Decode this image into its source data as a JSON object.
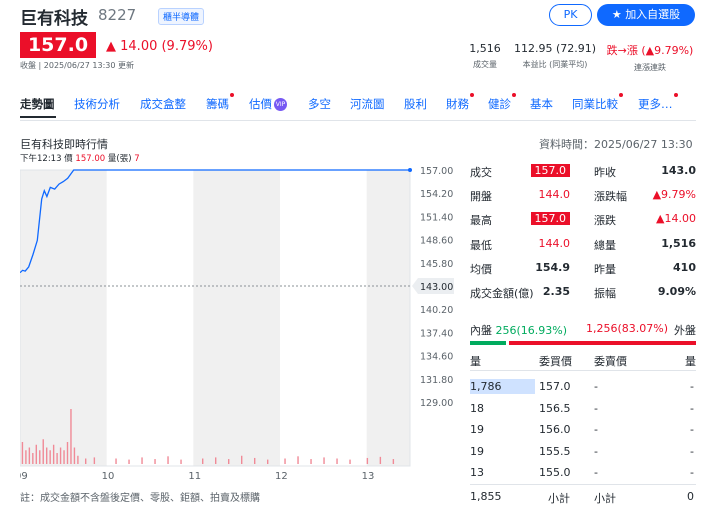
{
  "header": {
    "name": "巨有科技",
    "code": "8227",
    "badge": "櫃半導體",
    "pk": "PK",
    "watch": "加入自選股",
    "price": "157.0",
    "change": "14.00 (9.79%)",
    "close_time": "收盤 | 2025/06/27 13:30 更新"
  },
  "stats": [
    {
      "value": "1,516",
      "label": "成交量"
    },
    {
      "value": "112.95 (72.91)",
      "label": "本益比 (同業平均)"
    },
    {
      "value": "跌→漲 (▲9.79%)",
      "label": "連漲連跌"
    }
  ],
  "tabs": [
    "走勢圖",
    "技術分析",
    "成交盒整",
    "籌碼",
    "估價",
    "多空",
    "河流圖",
    "股利",
    "財務",
    "健診",
    "基本",
    "同業比較",
    "更多…"
  ],
  "tab_vip": "VIP",
  "chart": {
    "title": "巨有科技即時行情",
    "data_time": "資料時間：2025/06/27 13:30",
    "info_time": "下午12:13",
    "info_price_label": "價",
    "info_price": "157.00",
    "info_vol_label": "量(張)",
    "info_vol": "7",
    "ref_price": "143.00",
    "note": "註：成交金額不含盤後定價、零股、鉅額、拍賣及標購"
  },
  "chart_data": {
    "type": "line",
    "x_ticks": [
      "09",
      "10",
      "11",
      "12",
      "13"
    ],
    "y_ticks": [
      "157.00",
      "154.20",
      "151.40",
      "148.60",
      "145.80",
      "143.00",
      "140.20",
      "137.40",
      "134.60",
      "131.80",
      "129.00"
    ],
    "ylim": [
      129,
      157
    ],
    "reference": 143.0,
    "price_series": [
      {
        "t": 9.0,
        "v": 144.6
      },
      {
        "t": 9.03,
        "v": 144.9
      },
      {
        "t": 9.06,
        "v": 144.8
      },
      {
        "t": 9.1,
        "v": 145.3
      },
      {
        "t": 9.15,
        "v": 146.8
      },
      {
        "t": 9.2,
        "v": 148.5
      },
      {
        "t": 9.25,
        "v": 153.5
      },
      {
        "t": 9.28,
        "v": 154.5
      },
      {
        "t": 9.31,
        "v": 153.8
      },
      {
        "t": 9.35,
        "v": 154.9
      },
      {
        "t": 9.4,
        "v": 154.7
      },
      {
        "t": 9.45,
        "v": 155.3
      },
      {
        "t": 9.5,
        "v": 155.6
      },
      {
        "t": 9.55,
        "v": 156.0
      },
      {
        "t": 9.62,
        "v": 157.0
      },
      {
        "t": 10.0,
        "v": 157.0
      },
      {
        "t": 11.0,
        "v": 157.0
      },
      {
        "t": 12.0,
        "v": 157.0
      },
      {
        "t": 13.0,
        "v": 157.0
      },
      {
        "t": 13.5,
        "v": 157.0
      }
    ],
    "volume_series": [
      {
        "t": 9.02,
        "v": 40
      },
      {
        "t": 9.06,
        "v": 25
      },
      {
        "t": 9.1,
        "v": 30
      },
      {
        "t": 9.14,
        "v": 20
      },
      {
        "t": 9.18,
        "v": 35
      },
      {
        "t": 9.22,
        "v": 25
      },
      {
        "t": 9.26,
        "v": 45
      },
      {
        "t": 9.3,
        "v": 30
      },
      {
        "t": 9.34,
        "v": 25
      },
      {
        "t": 9.38,
        "v": 35
      },
      {
        "t": 9.42,
        "v": 20
      },
      {
        "t": 9.46,
        "v": 30
      },
      {
        "t": 9.5,
        "v": 25
      },
      {
        "t": 9.54,
        "v": 40
      },
      {
        "t": 9.58,
        "v": 100
      },
      {
        "t": 9.62,
        "v": 30
      },
      {
        "t": 9.66,
        "v": 15
      },
      {
        "t": 9.75,
        "v": 10
      },
      {
        "t": 9.85,
        "v": 12
      },
      {
        "t": 10.1,
        "v": 10
      },
      {
        "t": 10.25,
        "v": 8
      },
      {
        "t": 10.4,
        "v": 12
      },
      {
        "t": 10.55,
        "v": 9
      },
      {
        "t": 10.7,
        "v": 14
      },
      {
        "t": 10.85,
        "v": 8
      },
      {
        "t": 11.1,
        "v": 10
      },
      {
        "t": 11.25,
        "v": 12
      },
      {
        "t": 11.4,
        "v": 9
      },
      {
        "t": 11.55,
        "v": 15
      },
      {
        "t": 11.7,
        "v": 11
      },
      {
        "t": 11.85,
        "v": 8
      },
      {
        "t": 12.05,
        "v": 10
      },
      {
        "t": 12.2,
        "v": 14
      },
      {
        "t": 12.35,
        "v": 9
      },
      {
        "t": 12.5,
        "v": 12
      },
      {
        "t": 12.65,
        "v": 10
      },
      {
        "t": 12.8,
        "v": 8
      },
      {
        "t": 13.0,
        "v": 11
      },
      {
        "t": 13.15,
        "v": 13
      },
      {
        "t": 13.3,
        "v": 9
      }
    ]
  },
  "quote": {
    "left": [
      {
        "label": "成交",
        "value": "157.0",
        "style": "hl"
      },
      {
        "label": "開盤",
        "value": "144.0",
        "style": "red"
      },
      {
        "label": "最高",
        "value": "157.0",
        "style": "hl"
      },
      {
        "label": "最低",
        "value": "144.0",
        "style": "red"
      },
      {
        "label": "均價",
        "value": "154.9",
        "style": ""
      },
      {
        "label": "成交金額(億)",
        "value": "2.35",
        "style": ""
      }
    ],
    "right": [
      {
        "label": "昨收",
        "value": "143.0",
        "style": ""
      },
      {
        "label": "漲跌幅",
        "value": "▲9.79%",
        "style": "red"
      },
      {
        "label": "漲跌",
        "value": "▲14.00",
        "style": "red"
      },
      {
        "label": "總量",
        "value": "1,516",
        "style": ""
      },
      {
        "label": "昨量",
        "value": "410",
        "style": ""
      },
      {
        "label": "振幅",
        "value": "9.09%",
        "style": ""
      }
    ]
  },
  "inout": {
    "in_label": "內盤",
    "in_value": "256(16.93%)",
    "out_value": "1,256(83.07%)",
    "out_label": "外盤"
  },
  "orderbook": {
    "headers": [
      "量",
      "委買價",
      "委賣價",
      "量"
    ],
    "rows": [
      {
        "bid_vol": "1,786",
        "bid": "157.0",
        "ask": "-",
        "ask_vol": "-"
      },
      {
        "bid_vol": "18",
        "bid": "156.5",
        "ask": "-",
        "ask_vol": "-"
      },
      {
        "bid_vol": "19",
        "bid": "156.0",
        "ask": "-",
        "ask_vol": "-"
      },
      {
        "bid_vol": "19",
        "bid": "155.5",
        "ask": "-",
        "ask_vol": "-"
      },
      {
        "bid_vol": "13",
        "bid": "155.0",
        "ask": "-",
        "ask_vol": "-"
      }
    ],
    "total_bid": "1,855",
    "subtotal_label": "小計",
    "total_ask": "0"
  }
}
